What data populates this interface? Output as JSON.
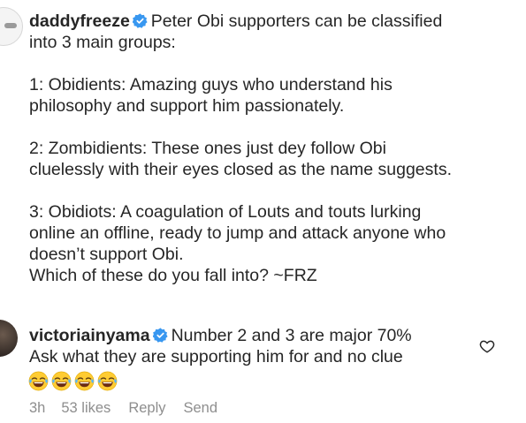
{
  "comment": {
    "username": "daddyfreeze",
    "verified_icon": "verified-badge-icon",
    "lines": {
      "intro_1": "Peter Obi supporters can be classified",
      "intro_2": "into 3 main groups:",
      "g1_1": "1: Obidients: Amazing guys who understand his",
      "g1_2": "philosophy and support him passionately.",
      "g2_1": "2: Zombidients: These ones just dey follow Obi",
      "g2_2": "cluelessly with their eyes closed as the name suggests.",
      "g3_1": "3: Obidiots: A coagulation of Louts and touts lurking",
      "g3_2": "online an offline, ready to jump and attack anyone who",
      "g3_3": "doesn’t support Obi.",
      "closing": "Which of these do you fall into? ~FRZ"
    }
  },
  "reply": {
    "username": "victoriainyama",
    "verified_icon": "verified-badge-icon",
    "line_1": "Number 2 and 3 are major 70%",
    "line_2": "Ask what they are supporting him for and no clue",
    "emojis": [
      "face-with-tears-of-joy",
      "face-with-tears-of-joy",
      "face-with-tears-of-joy",
      "face-with-tears-of-joy"
    ],
    "meta": {
      "time": "3h",
      "likes": "53 likes",
      "reply_label": "Reply",
      "send_label": "Send"
    },
    "like_icon": "heart-icon"
  },
  "colors": {
    "text": "#262626",
    "meta": "#8e8e8e",
    "verified": "#3897f0"
  }
}
